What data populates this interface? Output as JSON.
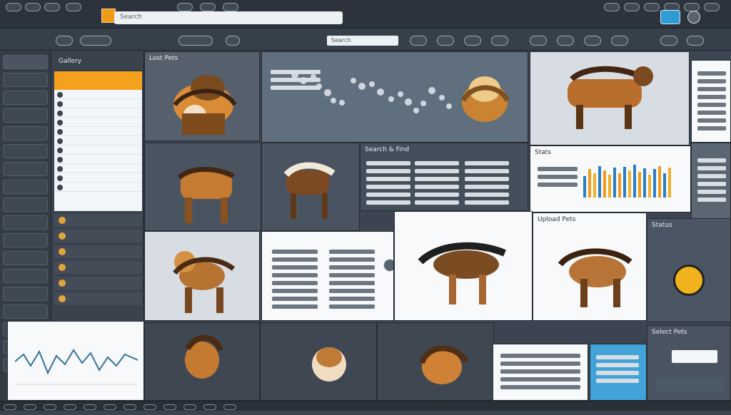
{
  "topbar": {
    "search_placeholder": "Search"
  },
  "secbar": {
    "field_placeholder": "Search"
  },
  "listcol": {
    "title": "Gallery"
  },
  "panels": {
    "left_top_title": "Lost Pets",
    "center_label": "Search & Find",
    "right_chart_title": "Stats",
    "bottom_right_title": "Status",
    "popup_title": "Upload Pets",
    "right_footer_title": "Select Pets"
  }
}
